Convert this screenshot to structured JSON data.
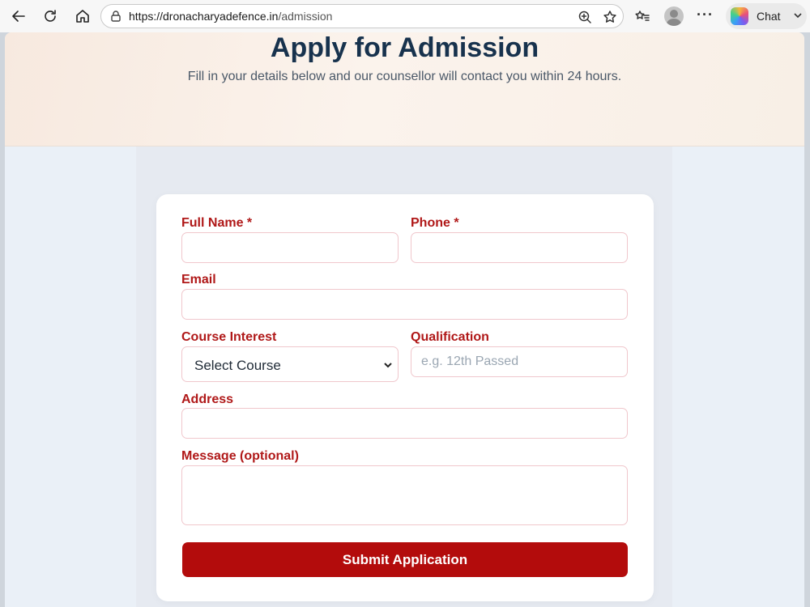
{
  "browser": {
    "url_host": "https://dronacharyadefence.in",
    "url_path": "/admission",
    "chat_label": "Chat",
    "more_label": "···"
  },
  "hero": {
    "title": "Apply for Admission",
    "subtitle": "Fill in your details below and our counsellor will contact you within 24 hours."
  },
  "form": {
    "full_name_label": "Full Name *",
    "full_name_value": "",
    "phone_label": "Phone *",
    "phone_value": "",
    "email_label": "Email",
    "email_value": "",
    "course_label": "Course Interest",
    "course_selected": "Select Course",
    "qualification_label": "Qualification",
    "qualification_placeholder": "e.g. 12th Passed",
    "address_label": "Address",
    "address_value": "",
    "message_label": "Message (optional)",
    "message_value": "",
    "submit_label": "Submit Application"
  },
  "colors": {
    "accent": "#b30c0c",
    "label": "#b01818",
    "title": "#17324d"
  }
}
